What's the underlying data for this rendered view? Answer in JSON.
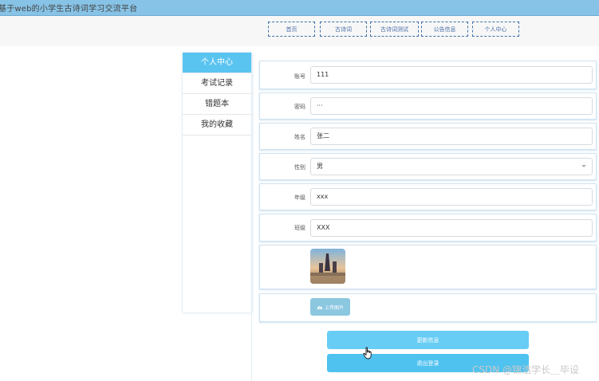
{
  "app": {
    "title": "基于web的小学生古诗词学习交流平台"
  },
  "nav": {
    "items": [
      {
        "label": "首页"
      },
      {
        "label": "古诗词"
      },
      {
        "label": "古诗词测试"
      },
      {
        "label": "公告信息"
      },
      {
        "label": "个人中心"
      }
    ]
  },
  "sidebar": {
    "items": [
      {
        "label": "个人中心",
        "active": true
      },
      {
        "label": "考试记录"
      },
      {
        "label": "错题本"
      },
      {
        "label": "我的收藏"
      }
    ]
  },
  "form": {
    "account": {
      "label": "账号",
      "value": "111"
    },
    "password": {
      "label": "密码",
      "value": "···"
    },
    "name": {
      "label": "姓名",
      "value": "张二"
    },
    "gender": {
      "label": "性别",
      "value": "男"
    },
    "grade": {
      "label": "年级",
      "value": "xxx"
    },
    "class": {
      "label": "班级",
      "value": "XXX"
    },
    "upload_label": "上传图片"
  },
  "actions": {
    "update_label": "更新信息",
    "logout_label": "退出登录"
  },
  "watermark": "CSDN @锦浩学长＿毕设",
  "colors": {
    "titlebar": "#87c3e6",
    "accent": "#5ac4f0",
    "nav_border": "#3f6fa8",
    "upload_button": "#8cc7e0"
  }
}
